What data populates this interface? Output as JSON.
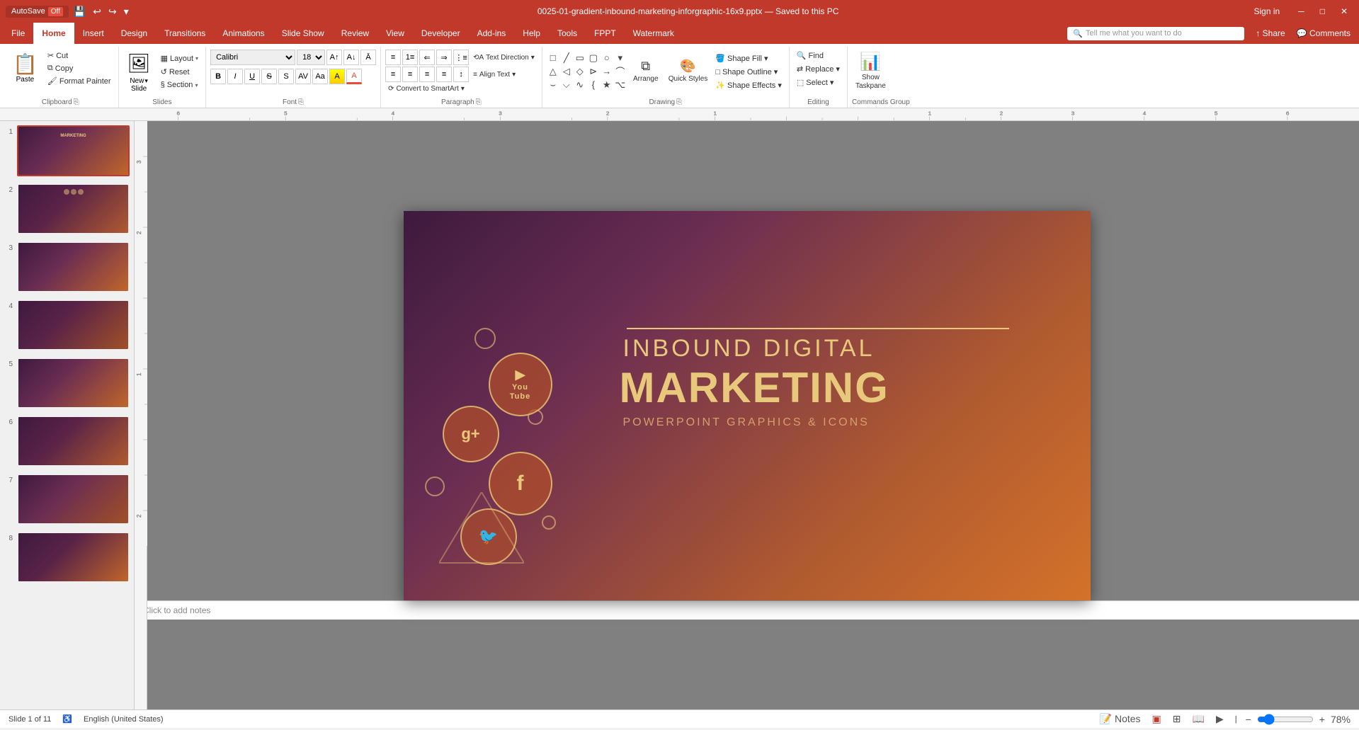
{
  "titlebar": {
    "autosave_label": "AutoSave",
    "autosave_state": "Off",
    "file_title": "0025-01-gradient-inbound-marketing-inforgraphic-16x9.pptx — Saved to this PC",
    "signin_label": "Sign in",
    "quick_access": {
      "save_tooltip": "Save",
      "undo_tooltip": "Undo",
      "redo_tooltip": "Redo",
      "customize_tooltip": "Customize Quick Access Toolbar"
    }
  },
  "tabs": {
    "items": [
      {
        "label": "File",
        "id": "file"
      },
      {
        "label": "Home",
        "id": "home",
        "active": true
      },
      {
        "label": "Insert",
        "id": "insert"
      },
      {
        "label": "Design",
        "id": "design"
      },
      {
        "label": "Transitions",
        "id": "transitions"
      },
      {
        "label": "Animations",
        "id": "animations"
      },
      {
        "label": "Slide Show",
        "id": "slideshow"
      },
      {
        "label": "Review",
        "id": "review"
      },
      {
        "label": "View",
        "id": "view"
      },
      {
        "label": "Developer",
        "id": "developer"
      },
      {
        "label": "Add-ins",
        "id": "addins"
      },
      {
        "label": "Help",
        "id": "help"
      },
      {
        "label": "Tools",
        "id": "tools"
      },
      {
        "label": "FPPT",
        "id": "fppt"
      },
      {
        "label": "Watermark",
        "id": "watermark"
      }
    ],
    "search_placeholder": "Tell me what you want to do",
    "share_label": "Share",
    "comments_label": "Comments"
  },
  "ribbon": {
    "clipboard": {
      "paste_label": "Paste",
      "cut_label": "Cut",
      "copy_label": "Copy",
      "format_painter_label": "Format Painter",
      "group_label": "Clipboard"
    },
    "slides": {
      "new_slide_label": "New\nSlide",
      "layout_label": "Layout",
      "reset_label": "Reset",
      "section_label": "Section",
      "group_label": "Slides"
    },
    "font": {
      "font_name": "Calibri",
      "font_size": "18",
      "grow_label": "A",
      "shrink_label": "A",
      "clear_label": "A",
      "bold_label": "B",
      "italic_label": "I",
      "underline_label": "U",
      "strikethrough_label": "S",
      "shadow_label": "S",
      "char_spacing_label": "AV",
      "change_case_label": "Aa",
      "font_color_label": "A",
      "group_label": "Font"
    },
    "paragraph": {
      "bullets_label": "≡",
      "numbering_label": "≡",
      "decrease_indent_label": "←",
      "increase_indent_label": "→",
      "text_direction_label": "Text Direction",
      "align_text_label": "Align Text",
      "convert_smartart_label": "Convert to SmartArt",
      "align_left_label": "≡",
      "center_label": "≡",
      "align_right_label": "≡",
      "justify_label": "≡",
      "columns_label": "≡",
      "line_spacing_label": "≡",
      "group_label": "Paragraph"
    },
    "drawing": {
      "shapes_label": "Shapes",
      "arrange_label": "Arrange",
      "quick_styles_label": "Quick Styles",
      "shape_fill_label": "Shape Fill",
      "shape_outline_label": "Shape Outline",
      "shape_effects_label": "Shape Effects",
      "group_label": "Drawing"
    },
    "editing": {
      "find_label": "Find",
      "replace_label": "Replace",
      "select_label": "Select",
      "group_label": "Editing"
    },
    "commands": {
      "show_taskpane_label": "Show\nTaskpane",
      "group_label": "Commands Group"
    }
  },
  "slide_panel": {
    "slides": [
      {
        "number": "1",
        "active": true
      },
      {
        "number": "2",
        "active": false
      },
      {
        "number": "3",
        "active": false
      },
      {
        "number": "4",
        "active": false
      },
      {
        "number": "5",
        "active": false
      },
      {
        "number": "6",
        "active": false
      },
      {
        "number": "7",
        "active": false
      },
      {
        "number": "8",
        "active": false
      }
    ]
  },
  "slide_content": {
    "heading": "INBOUND DIGITAL",
    "main_title": "MARKETING",
    "subtitle": "POWERPOINT GRAPHICS & ICONS"
  },
  "status_bar": {
    "slide_info": "Slide 1 of 11",
    "language": "English (United States)",
    "notes_label": "Notes",
    "zoom_level": "78%"
  },
  "notes": {
    "placeholder": "Click to add notes"
  }
}
